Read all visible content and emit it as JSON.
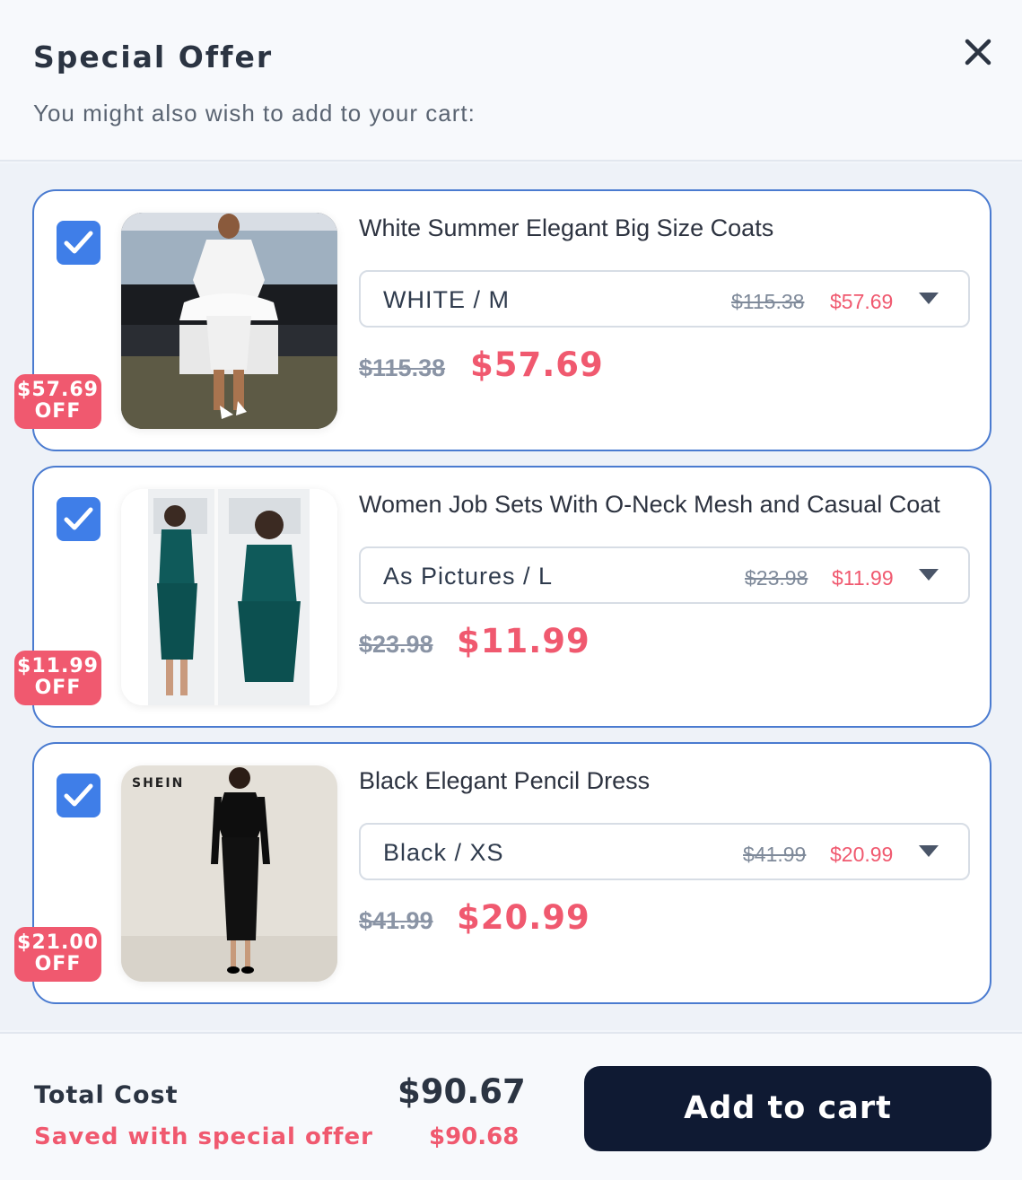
{
  "header": {
    "title": "Special Offer",
    "subtitle": "You might also wish to add to your cart:",
    "close_icon": "close-icon"
  },
  "products": [
    {
      "name": "White Summer Elegant Big Size Coats",
      "checked": true,
      "badge_amount": "$57.69",
      "badge_text": "OFF",
      "variant": "WHITE / M",
      "variant_old_price": "$115.38",
      "variant_new_price": "$57.69",
      "old_price": "$115.38",
      "new_price": "$57.69"
    },
    {
      "name": "Women Job Sets With O-Neck Mesh and Casual Coat",
      "checked": true,
      "badge_amount": "$11.99",
      "badge_text": "OFF",
      "variant": "As Pictures / L",
      "variant_old_price": "$23.98",
      "variant_new_price": "$11.99",
      "old_price": "$23.98",
      "new_price": "$11.99"
    },
    {
      "name": "Black Elegant Pencil Dress",
      "checked": true,
      "badge_amount": "$21.00",
      "badge_text": "OFF",
      "variant": "Black / XS",
      "variant_old_price": "$41.99",
      "variant_new_price": "$20.99",
      "old_price": "$41.99",
      "new_price": "$20.99",
      "image_brand_text": "SHEIN"
    }
  ],
  "footer": {
    "total_label": "Total Cost",
    "total_value": "$90.67",
    "saved_label": "Saved with special offer",
    "saved_value": "$90.68",
    "add_button": "Add to cart"
  },
  "colors": {
    "accent": "#f0596f",
    "checkbox": "#3f7ee8",
    "card_border": "#4a7bd0",
    "button_bg": "#0f1a33"
  }
}
